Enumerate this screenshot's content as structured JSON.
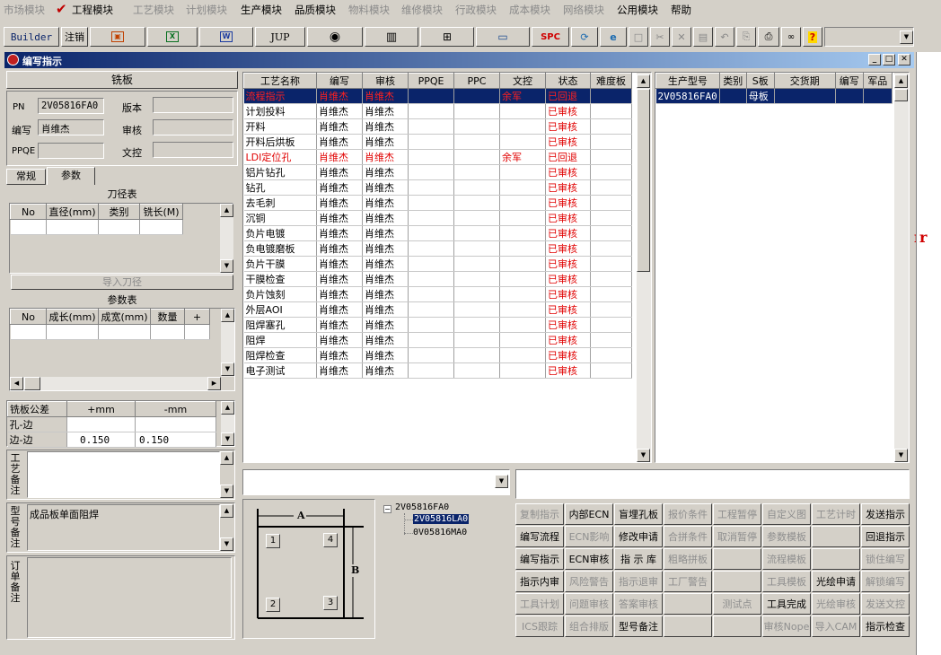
{
  "menu": [
    {
      "label": "市场模块",
      "enabled": false
    },
    {
      "label": "工程模块",
      "enabled": true
    },
    {
      "label": "工艺模块",
      "enabled": false
    },
    {
      "label": "计划模块",
      "enabled": false
    },
    {
      "label": "生产模块",
      "enabled": true
    },
    {
      "label": "品质模块",
      "enabled": true
    },
    {
      "label": "物料模块",
      "enabled": false
    },
    {
      "label": "维修模块",
      "enabled": false
    },
    {
      "label": "行政模块",
      "enabled": false
    },
    {
      "label": "成本模块",
      "enabled": false
    },
    {
      "label": "网络模块",
      "enabled": false
    },
    {
      "label": "公用模块",
      "enabled": true
    },
    {
      "label": "帮助",
      "enabled": true
    }
  ],
  "toolbar": {
    "builder": "Builder",
    "logout": "注销",
    "jup": "JUP",
    "spc": "SPC"
  },
  "window": {
    "title": "编写指示"
  },
  "board": {
    "title": "铣板",
    "pn_label": "PN",
    "pn_value": "2V05816FA0",
    "version_label": "版本",
    "version_value": "",
    "writer_label": "编写",
    "writer_value": "肖维杰",
    "review_label": "审核",
    "review_value": "",
    "ppqe_label": "PPQE",
    "ppqe_value": "",
    "doc_label": "文控",
    "doc_value": ""
  },
  "tabs": [
    "常规",
    "参数"
  ],
  "tool_table": {
    "title": "刀径表",
    "headers": [
      "No",
      "直径(mm)",
      "类别",
      "铣长(M)"
    ],
    "import_btn": "导入刀径"
  },
  "param_table": {
    "title": "参数表",
    "headers": [
      "No",
      "成长(mm)",
      "成宽(mm)",
      "数量",
      "+"
    ]
  },
  "tolerance": {
    "headers": [
      "铣板公差",
      "+mm",
      "-mm"
    ],
    "rows": [
      [
        "孔-边",
        "",
        ""
      ],
      [
        "边-边",
        "0.150",
        "0.150"
      ]
    ]
  },
  "notes": [
    {
      "label": "工艺备注",
      "value": ""
    },
    {
      "label": "型号备注",
      "value": "成品板单面阻焊"
    },
    {
      "label": "订单备注",
      "value": ""
    }
  ],
  "process_table": {
    "headers": [
      "工艺名称",
      "编写",
      "审核",
      "PPQE",
      "PPC",
      "文控",
      "状态",
      "难度板"
    ],
    "rows": [
      {
        "name": "流程指示",
        "writer": "肖维杰",
        "review": "肖维杰",
        "ppqe": "",
        "ppc": "",
        "doc": "余军",
        "status": "已回退",
        "style": "selected"
      },
      {
        "name": "计划投料",
        "writer": "肖维杰",
        "review": "肖维杰",
        "ppqe": "",
        "ppc": "",
        "doc": "",
        "status": "已审核",
        "style": "normal"
      },
      {
        "name": "开料",
        "writer": "肖维杰",
        "review": "肖维杰",
        "ppqe": "",
        "ppc": "",
        "doc": "",
        "status": "已审核",
        "style": "normal"
      },
      {
        "name": "开料后烘板",
        "writer": "肖维杰",
        "review": "肖维杰",
        "ppqe": "",
        "ppc": "",
        "doc": "",
        "status": "已审核",
        "style": "normal"
      },
      {
        "name": "LDI定位孔",
        "writer": "肖维杰",
        "review": "肖维杰",
        "ppqe": "",
        "ppc": "",
        "doc": "余军",
        "status": "已回退",
        "style": "red"
      },
      {
        "name": "铝片钻孔",
        "writer": "肖维杰",
        "review": "肖维杰",
        "ppqe": "",
        "ppc": "",
        "doc": "",
        "status": "已审核",
        "style": "normal"
      },
      {
        "name": "钻孔",
        "writer": "肖维杰",
        "review": "肖维杰",
        "ppqe": "",
        "ppc": "",
        "doc": "",
        "status": "已审核",
        "style": "normal"
      },
      {
        "name": "去毛刺",
        "writer": "肖维杰",
        "review": "肖维杰",
        "ppqe": "",
        "ppc": "",
        "doc": "",
        "status": "已审核",
        "style": "normal"
      },
      {
        "name": "沉铜",
        "writer": "肖维杰",
        "review": "肖维杰",
        "ppqe": "",
        "ppc": "",
        "doc": "",
        "status": "已审核",
        "style": "normal"
      },
      {
        "name": "负片电镀",
        "writer": "肖维杰",
        "review": "肖维杰",
        "ppqe": "",
        "ppc": "",
        "doc": "",
        "status": "已审核",
        "style": "normal"
      },
      {
        "name": "负电镀磨板",
        "writer": "肖维杰",
        "review": "肖维杰",
        "ppqe": "",
        "ppc": "",
        "doc": "",
        "status": "已审核",
        "style": "normal"
      },
      {
        "name": "负片干膜",
        "writer": "肖维杰",
        "review": "肖维杰",
        "ppqe": "",
        "ppc": "",
        "doc": "",
        "status": "已审核",
        "style": "normal"
      },
      {
        "name": "干膜检查",
        "writer": "肖维杰",
        "review": "肖维杰",
        "ppqe": "",
        "ppc": "",
        "doc": "",
        "status": "已审核",
        "style": "normal"
      },
      {
        "name": "负片蚀刻",
        "writer": "肖维杰",
        "review": "肖维杰",
        "ppqe": "",
        "ppc": "",
        "doc": "",
        "status": "已审核",
        "style": "normal"
      },
      {
        "name": "外层AOI",
        "writer": "肖维杰",
        "review": "肖维杰",
        "ppqe": "",
        "ppc": "",
        "doc": "",
        "status": "已审核",
        "style": "normal"
      },
      {
        "name": "阻焊塞孔",
        "writer": "肖维杰",
        "review": "肖维杰",
        "ppqe": "",
        "ppc": "",
        "doc": "",
        "status": "已审核",
        "style": "normal"
      },
      {
        "name": "阻焊",
        "writer": "肖维杰",
        "review": "肖维杰",
        "ppqe": "",
        "ppc": "",
        "doc": "",
        "status": "已审核",
        "style": "normal"
      },
      {
        "name": "阻焊检查",
        "writer": "肖维杰",
        "review": "肖维杰",
        "ppqe": "",
        "ppc": "",
        "doc": "",
        "status": "已审核",
        "style": "normal"
      },
      {
        "name": "电子测试",
        "writer": "肖维杰",
        "review": "肖维杰",
        "ppqe": "",
        "ppc": "",
        "doc": "",
        "status": "已审核",
        "style": "normal"
      }
    ]
  },
  "model_table": {
    "headers": [
      "生产型号",
      "类别",
      "S板",
      "交货期",
      "编写",
      "军品"
    ],
    "rows": [
      {
        "model": "2V05816FA0",
        "type": "",
        "sboard": "母板",
        "delivery": "",
        "writer": "",
        "military": ""
      }
    ]
  },
  "diagram": {
    "a": "A",
    "b": "B",
    "n1": "1",
    "n2": "2",
    "n3": "3",
    "n4": "4"
  },
  "tree": {
    "root": "2V05816FA0",
    "child_selected": "2V05816LA0",
    "child2": "0V05816MA0"
  },
  "colors": {
    "accent": "#0a246a",
    "alert": "#e00000",
    "bg": "#d4d0c8"
  },
  "buttons": [
    [
      {
        "label": "复制指示",
        "enabled": false
      },
      {
        "label": "内部ECN",
        "enabled": true
      },
      {
        "label": "盲埋孔板",
        "enabled": true
      },
      {
        "label": "报价条件",
        "enabled": false
      },
      {
        "label": "工程暂停",
        "enabled": false
      },
      {
        "label": "自定义图",
        "enabled": false
      },
      {
        "label": "工艺计时",
        "enabled": false
      },
      {
        "label": "发送指示",
        "enabled": true
      }
    ],
    [
      {
        "label": "编写流程",
        "enabled": true
      },
      {
        "label": "ECN影响",
        "enabled": false
      },
      {
        "label": "修改申请",
        "enabled": true
      },
      {
        "label": "合拼条件",
        "enabled": false
      },
      {
        "label": "取消暂停",
        "enabled": false
      },
      {
        "label": "参数模板",
        "enabled": false
      },
      {
        "label": "",
        "enabled": false
      },
      {
        "label": "回退指示",
        "enabled": true
      }
    ],
    [
      {
        "label": "编写指示",
        "enabled": true
      },
      {
        "label": "ECN审核",
        "enabled": true
      },
      {
        "label": "指 示 库",
        "enabled": true
      },
      {
        "label": "粗略拼板",
        "enabled": false
      },
      {
        "label": "",
        "enabled": false
      },
      {
        "label": "流程模板",
        "enabled": false
      },
      {
        "label": "",
        "enabled": false
      },
      {
        "label": "锁住编写",
        "enabled": false
      }
    ],
    [
      {
        "label": "指示内审",
        "enabled": true
      },
      {
        "label": "风险警告",
        "enabled": false
      },
      {
        "label": "指示退审",
        "enabled": false
      },
      {
        "label": "工厂警告",
        "enabled": false
      },
      {
        "label": "",
        "enabled": false
      },
      {
        "label": "工具模板",
        "enabled": false
      },
      {
        "label": "光绘申请",
        "enabled": true
      },
      {
        "label": "解锁编写",
        "enabled": false
      }
    ],
    [
      {
        "label": "工具计划",
        "enabled": false
      },
      {
        "label": "问题审核",
        "enabled": false
      },
      {
        "label": "答案审核",
        "enabled": false
      },
      {
        "label": "",
        "enabled": false
      },
      {
        "label": "测试点",
        "enabled": false
      },
      {
        "label": "工具完成",
        "enabled": true
      },
      {
        "label": "光绘审核",
        "enabled": false
      },
      {
        "label": "发送文控",
        "enabled": false
      }
    ],
    [
      {
        "label": "ICS跟踪",
        "enabled": false
      },
      {
        "label": "组合排版",
        "enabled": false
      },
      {
        "label": "型号备注",
        "enabled": true
      },
      {
        "label": "",
        "enabled": false
      },
      {
        "label": "",
        "enabled": false
      },
      {
        "label": "审核Nope",
        "enabled": false
      },
      {
        "label": "导入CAM",
        "enabled": false
      },
      {
        "label": "指示检查",
        "enabled": true
      }
    ]
  ]
}
